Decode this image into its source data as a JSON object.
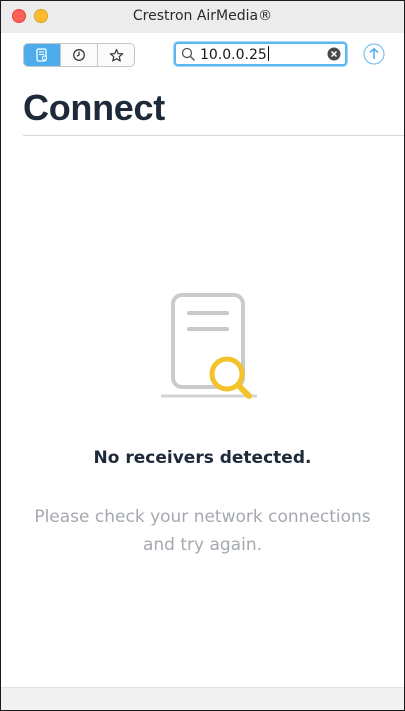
{
  "window": {
    "title": "Crestron AirMedia®"
  },
  "toolbar": {
    "segments": [
      {
        "icon": "receivers-icon",
        "active": true
      },
      {
        "icon": "history-clock-icon",
        "active": false
      },
      {
        "icon": "favorites-star-icon",
        "active": false
      }
    ],
    "search": {
      "value": "10.0.0.25"
    },
    "upload_icon": "upload-arrow-icon"
  },
  "main": {
    "title": "Connect",
    "empty_state": {
      "icon": "document-search-icon",
      "title": "No receivers detected.",
      "message_line1": "Please check your network connections",
      "message_line2": "and try again."
    }
  },
  "colors": {
    "accent": "#4dacec",
    "title_text": "#1e2a3a",
    "muted_text": "#a4a9b0",
    "illustration_gray": "#c9cacc",
    "magnifier_yellow": "#f3c32b"
  }
}
